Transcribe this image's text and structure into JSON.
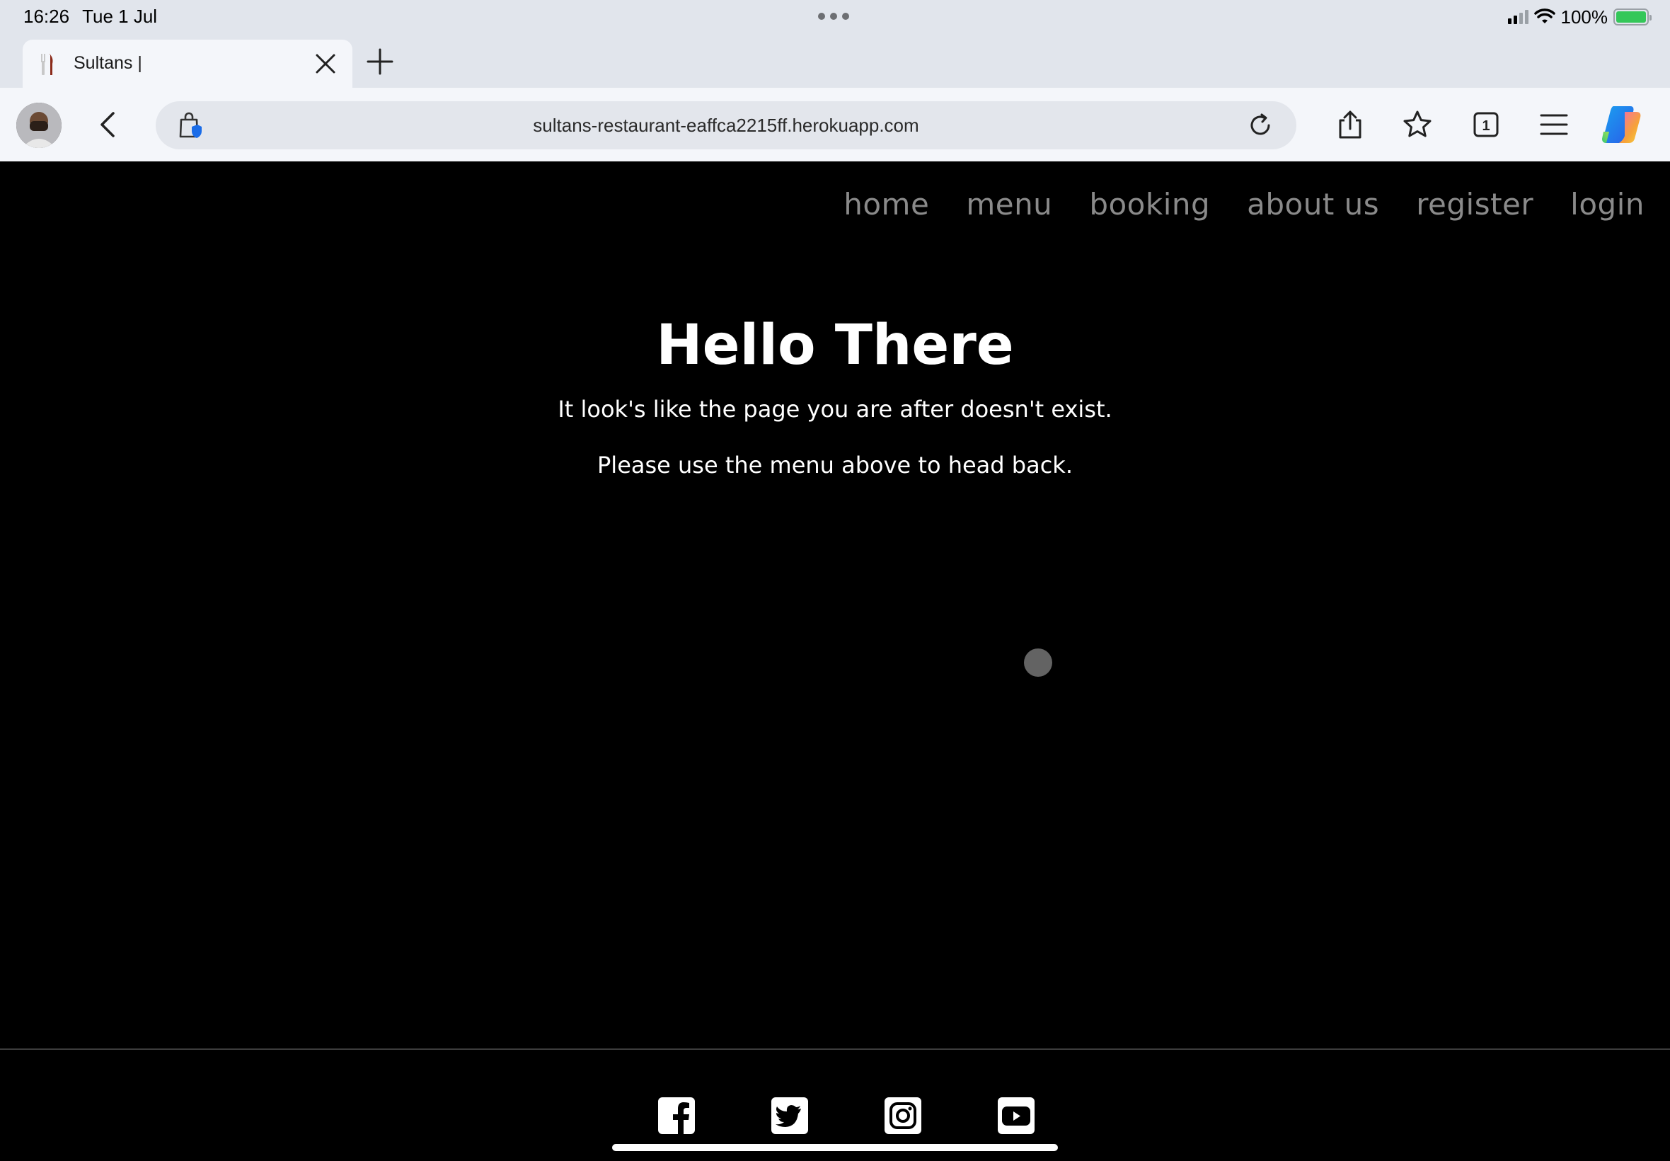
{
  "status_bar": {
    "time": "16:26",
    "date": "Tue 1 Jul",
    "battery": "100%",
    "battery_color": "#34c759"
  },
  "tab": {
    "title": "Sultans |",
    "favicon": "fork-knife-icon"
  },
  "toolbar": {
    "url": "sultans-restaurant-eaffca2215ff.herokuapp.com",
    "tab_count": "1",
    "icons": [
      "back-icon",
      "shield-bag-icon",
      "reload-icon",
      "share-icon",
      "star-icon",
      "tabs-icon",
      "menu-icon",
      "copilot-icon"
    ]
  },
  "nav": {
    "items": [
      "home",
      "menu",
      "booking",
      "about us",
      "register",
      "login"
    ]
  },
  "main": {
    "heading": "Hello There",
    "message1": "It look's like the page you are after doesn't exist.",
    "message2": "Please use the menu above to head back."
  },
  "footer": {
    "social": [
      "facebook-icon",
      "twitter-icon",
      "instagram-icon",
      "youtube-icon"
    ]
  },
  "colors": {
    "page_bg": "#000000",
    "nav_text": "#8a8a8a",
    "heading_text": "#ffffff",
    "browser_chrome": "#e1e5ec"
  }
}
